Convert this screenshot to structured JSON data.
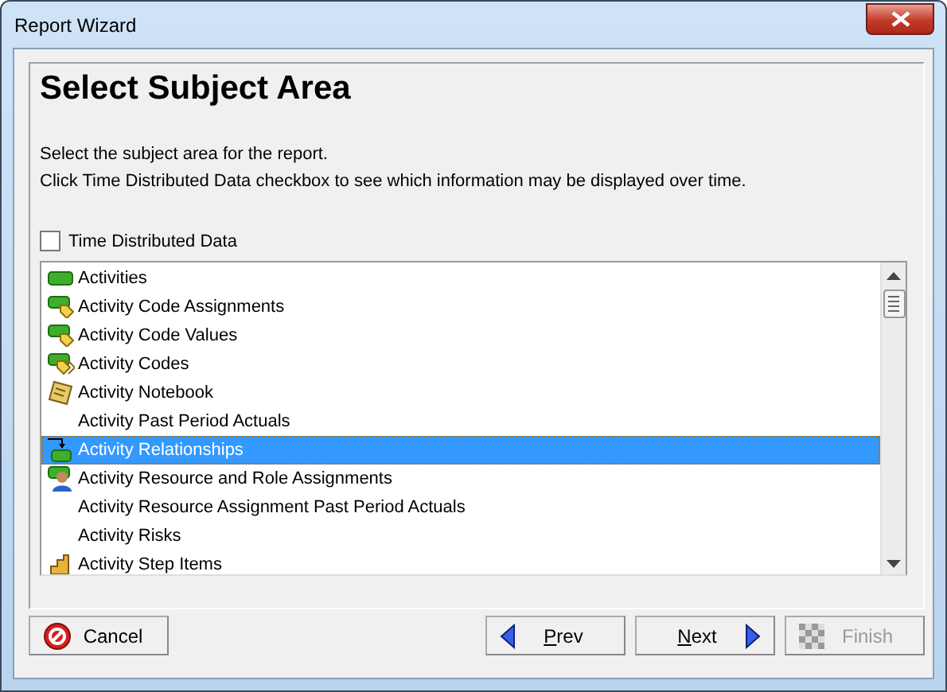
{
  "window": {
    "title": "Report Wizard"
  },
  "heading": "Select Subject Area",
  "instructions": [
    "Select the subject area for the report.",
    "Click Time Distributed Data checkbox to see which information may be displayed over time."
  ],
  "time_distributed": {
    "label": "Time Distributed Data",
    "checked": false
  },
  "subject_areas": [
    {
      "label": "Activities",
      "kind": "bar",
      "selected": false
    },
    {
      "label": "Activity Code Assignments",
      "kind": "code",
      "selected": false
    },
    {
      "label": "Activity Code Values",
      "kind": "code",
      "selected": false
    },
    {
      "label": "Activity Codes",
      "kind": "codes",
      "selected": false
    },
    {
      "label": "Activity Notebook",
      "kind": "notebook",
      "selected": false
    },
    {
      "label": "Activity Past Period Actuals",
      "kind": "none",
      "selected": false
    },
    {
      "label": "Activity Relationships",
      "kind": "relationship",
      "selected": true
    },
    {
      "label": "Activity Resource and Role Assignments",
      "kind": "resource",
      "selected": false
    },
    {
      "label": "Activity Resource Assignment Past Period Actuals",
      "kind": "none",
      "selected": false
    },
    {
      "label": "Activity Risks",
      "kind": "none",
      "selected": false
    },
    {
      "label": "Activity Step Items",
      "kind": "step",
      "selected": false
    }
  ],
  "buttons": [
    {
      "label": "Cancel",
      "kind": "cancel",
      "underline_first": false,
      "disabled": false
    },
    {
      "label": "Prev",
      "kind": "prev",
      "underline_first": true,
      "disabled": false
    },
    {
      "label": "Next",
      "kind": "next",
      "underline_first": true,
      "disabled": false
    },
    {
      "label": "Finish",
      "kind": "finish",
      "underline_first": false,
      "disabled": true
    }
  ]
}
